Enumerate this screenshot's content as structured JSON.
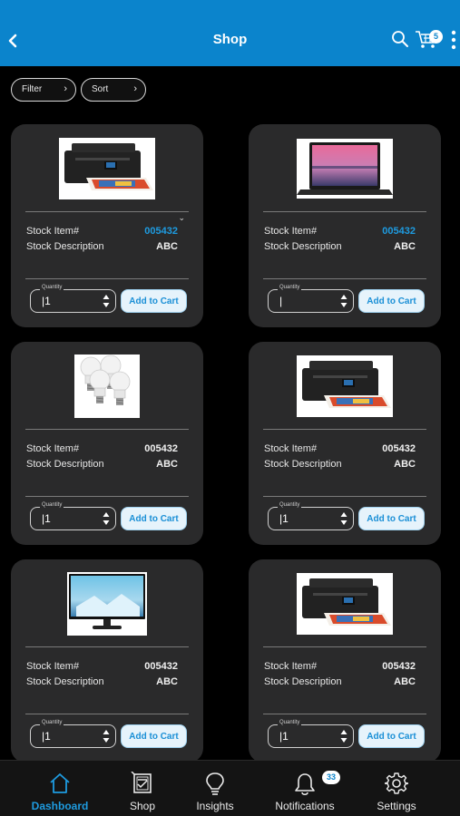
{
  "header": {
    "title": "Shop",
    "cart_count": "5",
    "icons": [
      "back-icon",
      "search-icon",
      "cart-icon",
      "more-icon"
    ],
    "color": "#0b84cc"
  },
  "toolbar": {
    "filter_label": "Filter",
    "sort_label": "Sort",
    "chevron": "›"
  },
  "labels": {
    "stock_item": "Stock Item#",
    "stock_description": "Stock Description",
    "quantity": "Quantity",
    "add_to_cart": "Add to Cart"
  },
  "products": [
    {
      "image": "printer",
      "stock_item": "005432",
      "description": "ABC",
      "quantity": "1",
      "highlight": true
    },
    {
      "image": "laptop",
      "stock_item": "005432",
      "description": "ABC",
      "quantity": "",
      "highlight": true
    },
    {
      "image": "bulbs",
      "stock_item": "005432",
      "description": "ABC",
      "quantity": "1",
      "highlight": false
    },
    {
      "image": "printer",
      "stock_item": "005432",
      "description": "ABC",
      "quantity": "1",
      "highlight": false
    },
    {
      "image": "monitor",
      "stock_item": "005432",
      "description": "ABC",
      "quantity": "1",
      "highlight": false
    },
    {
      "image": "printer",
      "stock_item": "005432",
      "description": "ABC",
      "quantity": "1",
      "highlight": false
    }
  ],
  "bottom_nav": {
    "dashboard": "Dashboard",
    "shop": "Shop",
    "insights": "Insights",
    "notifications": "Notifications",
    "notifications_count": "33",
    "settings": "Settings",
    "active": "dashboard"
  },
  "colors": {
    "accent": "#1e9be0",
    "card": "#2a2a2b",
    "background": "#000000"
  }
}
